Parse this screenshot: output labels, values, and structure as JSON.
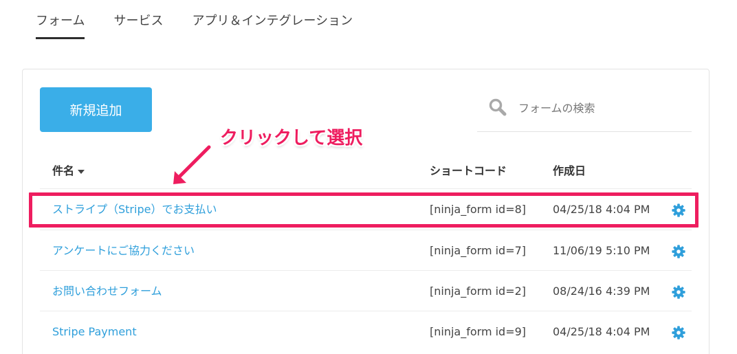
{
  "tabs": [
    {
      "label": "フォーム",
      "active": true
    },
    {
      "label": "サービス",
      "active": false
    },
    {
      "label": "アプリ＆インテグレーション",
      "active": false
    }
  ],
  "toolbar": {
    "add_label": "新規追加",
    "search_placeholder": "フォームの検索",
    "search_icon": "search-icon"
  },
  "annotation": {
    "text": "クリックして選択",
    "color": "#ee1d5f"
  },
  "table": {
    "columns": {
      "name": "件名",
      "shortcode": "ショートコード",
      "created": "作成日"
    },
    "rows": [
      {
        "title": "ストライプ（Stripe）でお支払い",
        "shortcode": "[ninja_form id=8]",
        "date": "04/25/18 4:04 PM",
        "highlighted": true
      },
      {
        "title": "アンケートにご協力ください",
        "shortcode": "[ninja_form id=7]",
        "date": "11/06/19 5:10 PM",
        "highlighted": false
      },
      {
        "title": "お問い合わせフォーム",
        "shortcode": "[ninja_form id=2]",
        "date": "08/24/16 4:39 PM",
        "highlighted": false
      },
      {
        "title": "Stripe Payment",
        "shortcode": "[ninja_form id=9]",
        "date": "04/25/18 4:04 PM",
        "highlighted": false
      }
    ]
  },
  "colors": {
    "accent": "#3aaee8",
    "link": "#2f9fdb",
    "highlight": "#ee1d5f"
  }
}
